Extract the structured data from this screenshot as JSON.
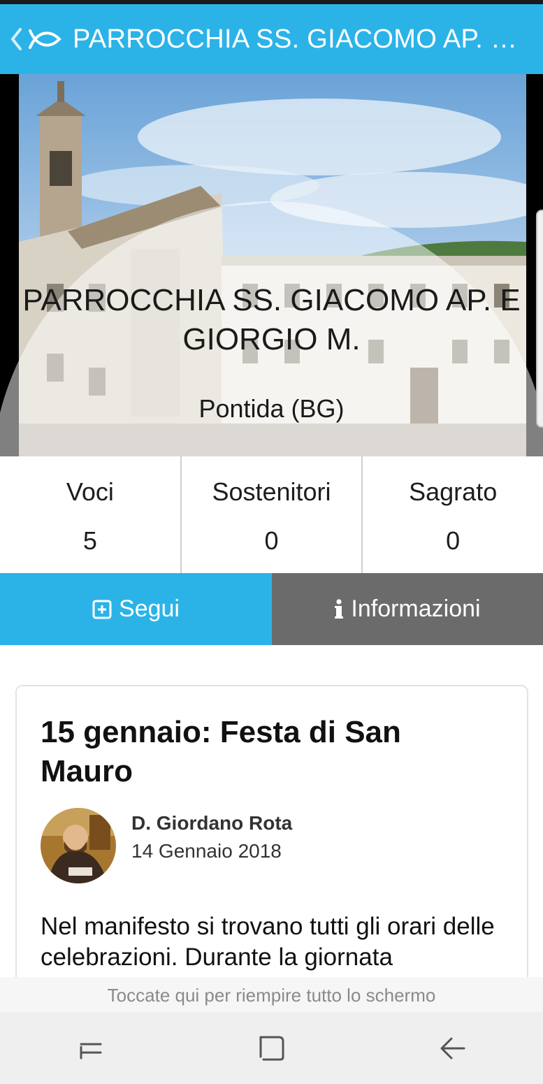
{
  "app_bar": {
    "title": "PARROCCHIA SS. GIACOMO AP. E GI..."
  },
  "hero": {
    "name": "PARROCCHIA SS. GIACOMO AP. E GIORGIO M.",
    "place": "Pontida (BG)"
  },
  "stats": [
    {
      "label": "Voci",
      "value": "5"
    },
    {
      "label": "Sostenitori",
      "value": "0"
    },
    {
      "label": "Sagrato",
      "value": "0"
    }
  ],
  "actions": {
    "follow_label": "Segui",
    "info_label": "Informazioni"
  },
  "post": {
    "title": "15 gennaio: Festa di San Mauro",
    "author": "D. Giordano Rota",
    "date": "14 Gennaio 2018",
    "body": "Nel manifesto si trovano tutti gli orari delle celebrazioni. Durante la giornata"
  },
  "fullscreen_hint": "Toccate qui per riempire tutto lo schermo",
  "colors": {
    "accent": "#2bb3e8",
    "info_button": "#6b6b6b"
  },
  "icons": {
    "back": "chevron-left-icon",
    "logo": "fish-icon",
    "follow": "plus-square-icon",
    "info": "info-icon",
    "nav_recent": "recent-apps-icon",
    "nav_home": "home-icon",
    "nav_back": "back-arrow-icon"
  }
}
